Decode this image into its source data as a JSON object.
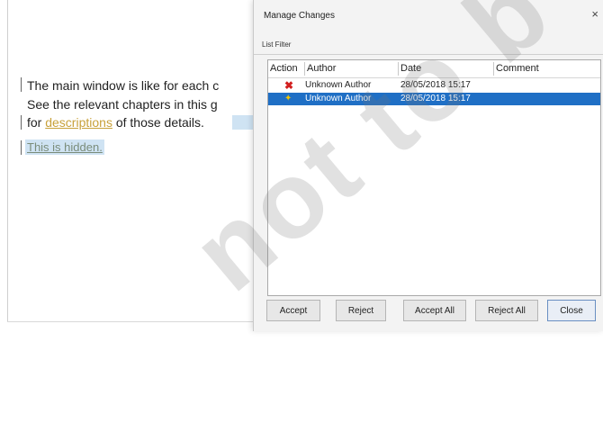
{
  "document": {
    "line1": "The main window is like for each c",
    "line2": "See the relevant chapters in this g",
    "line3_prefix": "for ",
    "line3_inserted": "descriptions",
    "line3_suffix": " of those details.",
    "hidden_text": "This is hidden."
  },
  "dialog": {
    "title": "Manage Changes",
    "close_glyph": "×",
    "tab_label": "List Filter",
    "columns": [
      "Action",
      "Author",
      "Date",
      "Comment"
    ],
    "rows": [
      {
        "action_icon": "delete-icon",
        "author": "Unknown Author",
        "date": "28/05/2018 15:17",
        "comment": "",
        "selected": false
      },
      {
        "action_icon": "insert-icon",
        "author": "Unknown Author",
        "date": "28/05/2018 15:17",
        "comment": "",
        "selected": true
      }
    ],
    "buttons": {
      "accept": "Accept",
      "reject": "Reject",
      "accept_all": "Accept All",
      "reject_all": "Reject All",
      "close": "Close"
    }
  },
  "watermark": "not to b"
}
